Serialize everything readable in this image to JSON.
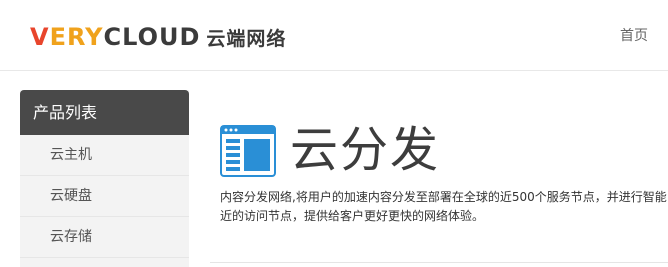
{
  "header": {
    "logo": {
      "wordmark_parts": [
        "V",
        "ERY",
        "CLOUD"
      ],
      "wordmark_colors": [
        "#e8452c",
        "#f0a21c",
        "#3b3b3b"
      ],
      "chinese_name": "云端网络"
    },
    "nav_home": "首页"
  },
  "sidebar": {
    "title": "产品列表",
    "items": [
      {
        "label": "云主机"
      },
      {
        "label": "云硬盘"
      },
      {
        "label": "云存储"
      }
    ]
  },
  "main": {
    "icon": "web-window-icon",
    "title": "云分发",
    "description_lines": [
      "内容分发网络,将用户的加速内容分发至部署在全球的近500个服务节点，并进行智能",
      "近的访问节点，提供给客户更好更快的网络体验。"
    ]
  },
  "colors": {
    "sidebar_title_bg": "#494949",
    "sidebar_bg": "#f3f3f3",
    "icon_blue": "#2a8fd6"
  }
}
